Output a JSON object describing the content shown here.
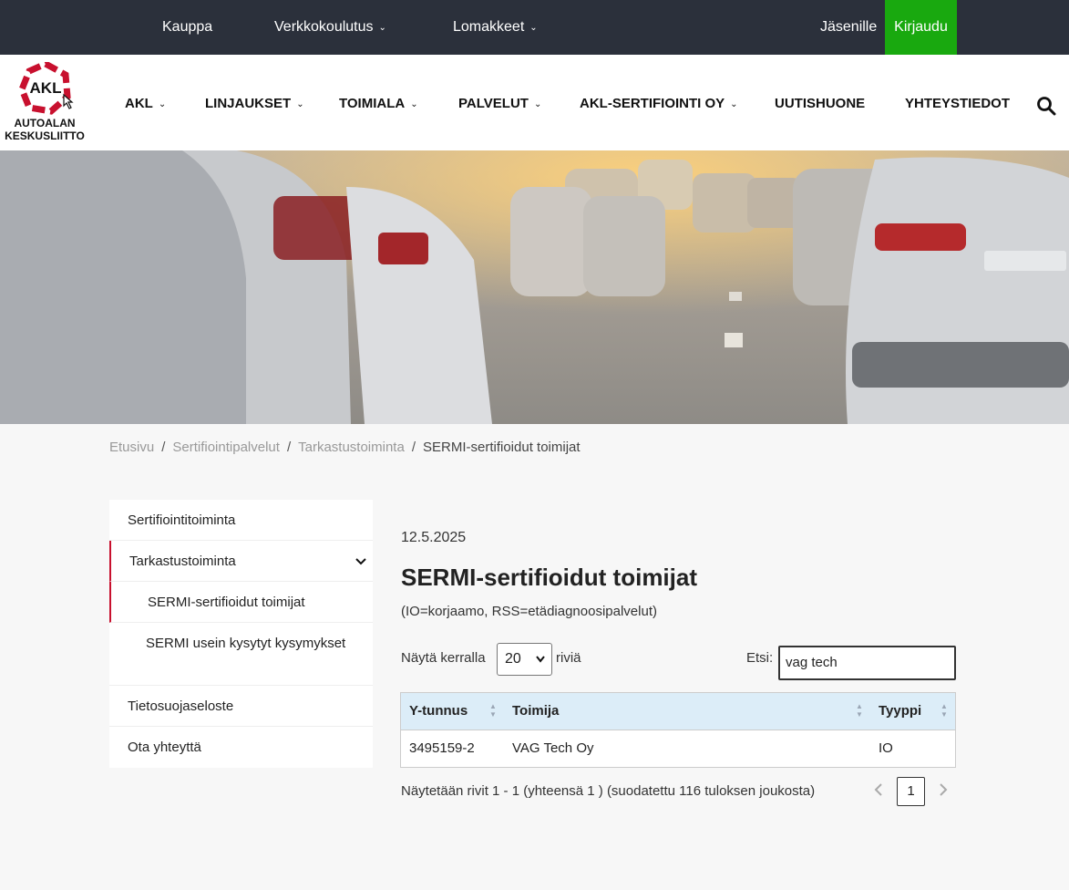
{
  "topbar": {
    "links": [
      {
        "label": "Kauppa",
        "dropdown": false
      },
      {
        "label": "Verkkokoulutus",
        "dropdown": true
      },
      {
        "label": "Lomakkeet",
        "dropdown": true
      }
    ],
    "members": "Jäsenille",
    "login": "Kirjaudu"
  },
  "logo": {
    "mark": "AKL",
    "line1": "AUTOALAN",
    "line2": "KESKUSLIITTO"
  },
  "mainnav": [
    "AKL",
    "LINJAUKSET",
    "TOIMIALA",
    "PALVELUT",
    "AKL-SERTIFIOINTI OY",
    "UUTISHUONE",
    "YHTEYSTIEDOT"
  ],
  "breadcrumb": [
    "Etusivu",
    "Sertifiointipalvelut",
    "Tarkastustoiminta",
    "SERMI-sertifioidut toimijat"
  ],
  "sidebar": {
    "items": [
      "Sertifiointitoiminta",
      "Tarkastustoiminta",
      "SERMI-sertifioidut toimijat",
      "SERMI usein kysytyt kysymykset",
      "Tietosuojaseloste",
      "Ota yhteyttä"
    ]
  },
  "content": {
    "date": "12.5.2025",
    "title": "SERMI-sertifioidut toimijat",
    "subtitle": "(IO=korjaamo, RSS=etädiagnoosipalvelut)",
    "show_label": "Näytä kerralla",
    "show_value": "20",
    "rows_label": "riviä",
    "search_label": "Etsi:",
    "search_value": "vag tech"
  },
  "table": {
    "headers": [
      "Y-tunnus",
      "Toimija",
      "Tyyppi"
    ],
    "rows": [
      [
        "3495159-2",
        "VAG Tech Oy",
        "IO"
      ]
    ]
  },
  "pagination": {
    "info": "Näytetään rivit 1 - 1 (yhteensä 1 ) (suodatettu 116 tuloksen joukosta)",
    "current_page": "1"
  },
  "colors": {
    "topbar": "#2b303b",
    "login": "#19a90f",
    "accent": "#c8102e",
    "table_header": "#dcedf8"
  }
}
